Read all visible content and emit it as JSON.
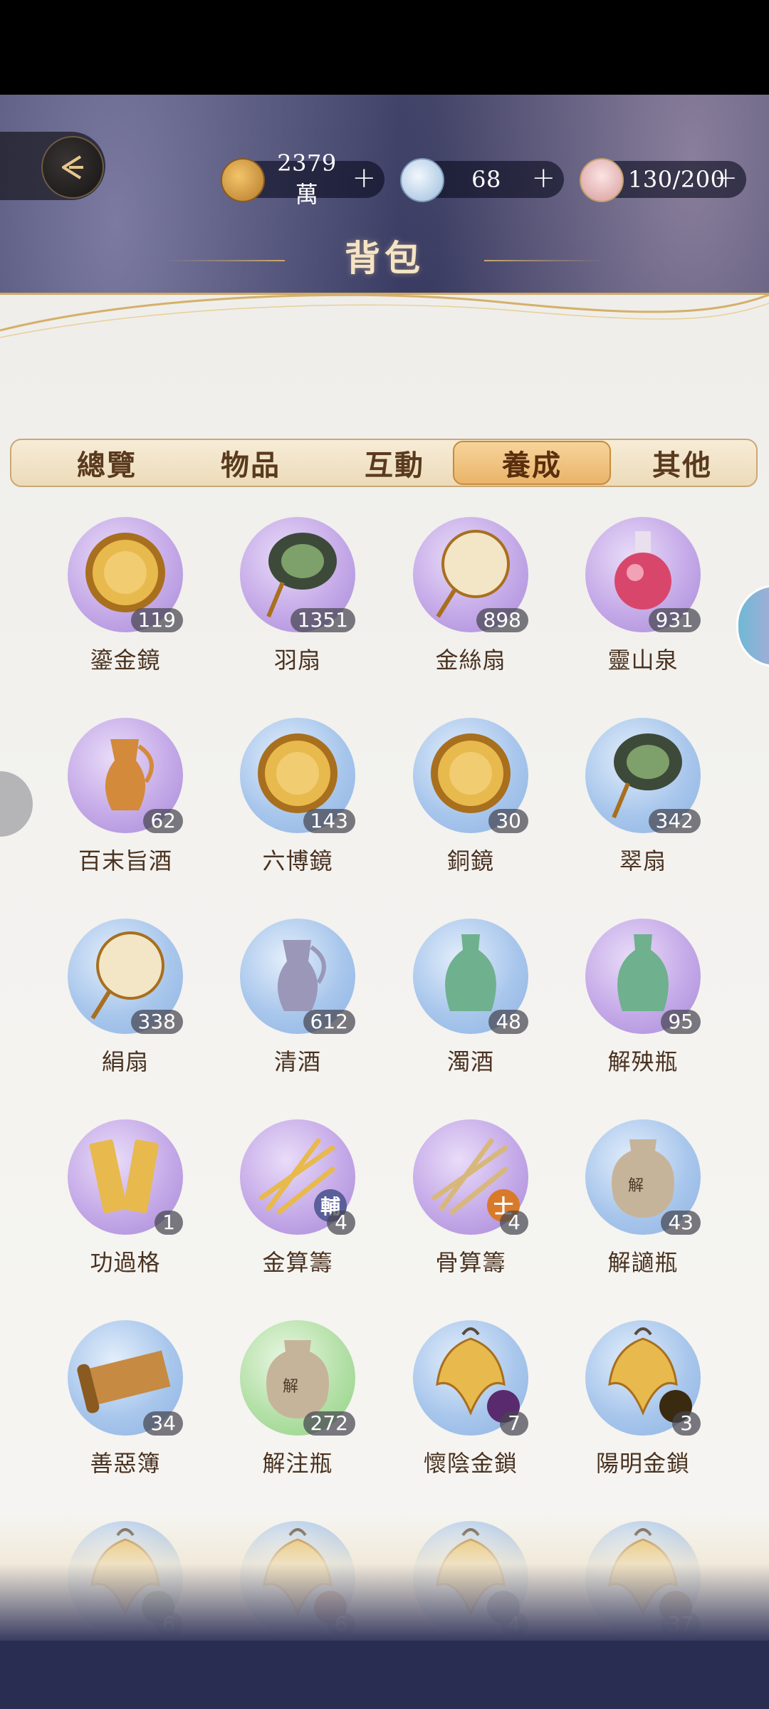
{
  "currencies": [
    {
      "name": "copper-coin",
      "value": "2379萬",
      "plus": "+",
      "color": "#c9923e"
    },
    {
      "name": "jade-orb",
      "value": "68",
      "plus": "+",
      "color": "#b8d3ea"
    },
    {
      "name": "stamina-bowl",
      "value": "130/200",
      "plus": "+",
      "color": "#e8b6b6"
    }
  ],
  "title": "背包",
  "tabs": [
    {
      "label": "總覽",
      "active": false
    },
    {
      "label": "物品",
      "active": false
    },
    {
      "label": "互動",
      "active": false
    },
    {
      "label": "養成",
      "active": true
    },
    {
      "label": "其他",
      "active": false
    }
  ],
  "items": [
    {
      "name": "鎏金鏡",
      "count": "119",
      "bg": "purple",
      "icon": "gold-mirror-icon"
    },
    {
      "name": "羽扇",
      "count": "1351",
      "bg": "purple",
      "icon": "feather-fan-icon"
    },
    {
      "name": "金絲扇",
      "count": "898",
      "bg": "purple",
      "icon": "round-fan-icon"
    },
    {
      "name": "靈山泉",
      "count": "931",
      "bg": "purple",
      "icon": "potion-bottle-icon"
    },
    {
      "name": "百末旨酒",
      "count": "62",
      "bg": "purple",
      "icon": "gold-ewer-icon"
    },
    {
      "name": "六博鏡",
      "count": "143",
      "bg": "blue",
      "icon": "bronze-mirror-icon"
    },
    {
      "name": "銅鏡",
      "count": "30",
      "bg": "blue",
      "icon": "copper-mirror-icon"
    },
    {
      "name": "翠扇",
      "count": "342",
      "bg": "blue",
      "icon": "peacock-fan-icon"
    },
    {
      "name": "絹扇",
      "count": "338",
      "bg": "blue",
      "icon": "silk-fan-icon"
    },
    {
      "name": "清酒",
      "count": "612",
      "bg": "blue",
      "icon": "silver-ewer-icon"
    },
    {
      "name": "濁酒",
      "count": "48",
      "bg": "blue",
      "icon": "celadon-vase-icon"
    },
    {
      "name": "解殃瓶",
      "count": "95",
      "bg": "purple",
      "icon": "jade-vase-icon"
    },
    {
      "name": "功過格",
      "count": "1",
      "bg": "purple",
      "icon": "bamboo-slips-icon"
    },
    {
      "name": "金算籌",
      "count": "4",
      "bg": "purple",
      "icon": "gold-sticks-icon",
      "badge": "輔",
      "badge_color": "#5a5f9a"
    },
    {
      "name": "骨算籌",
      "count": "4",
      "bg": "purple",
      "icon": "bone-sticks-icon",
      "badge": "士",
      "badge_color": "#d97a2a"
    },
    {
      "name": "解讁瓶",
      "count": "43",
      "bg": "blue",
      "icon": "clay-jar-icon"
    },
    {
      "name": "善惡簿",
      "count": "34",
      "bg": "blue",
      "icon": "scroll-icon"
    },
    {
      "name": "解注瓶",
      "count": "272",
      "bg": "green",
      "icon": "clay-jar-icon"
    },
    {
      "name": "懷陰金鎖",
      "count": "7",
      "bg": "blue",
      "icon": "gold-lock-icon",
      "badge": "",
      "badge_color": "#5a2a6e"
    },
    {
      "name": "陽明金鎖",
      "count": "3",
      "bg": "blue",
      "icon": "gold-lock-icon",
      "badge": "",
      "badge_color": "#3a2a10"
    },
    {
      "name": "",
      "count": "6",
      "bg": "blue",
      "icon": "gold-lock-icon",
      "badge": "",
      "badge_color": "#1f5a3a"
    },
    {
      "name": "",
      "count": "6",
      "bg": "blue",
      "icon": "gold-lock-icon",
      "badge": "",
      "badge_color": "#6a1e14"
    },
    {
      "name": "",
      "count": "4",
      "bg": "blue",
      "icon": "gold-lock-icon",
      "badge": "",
      "badge_color": "#1e3e7a"
    },
    {
      "name": "",
      "count": "37",
      "bg": "blue",
      "icon": "gold-lock-icon",
      "badge": "",
      "badge_color": "#4a3420"
    }
  ]
}
